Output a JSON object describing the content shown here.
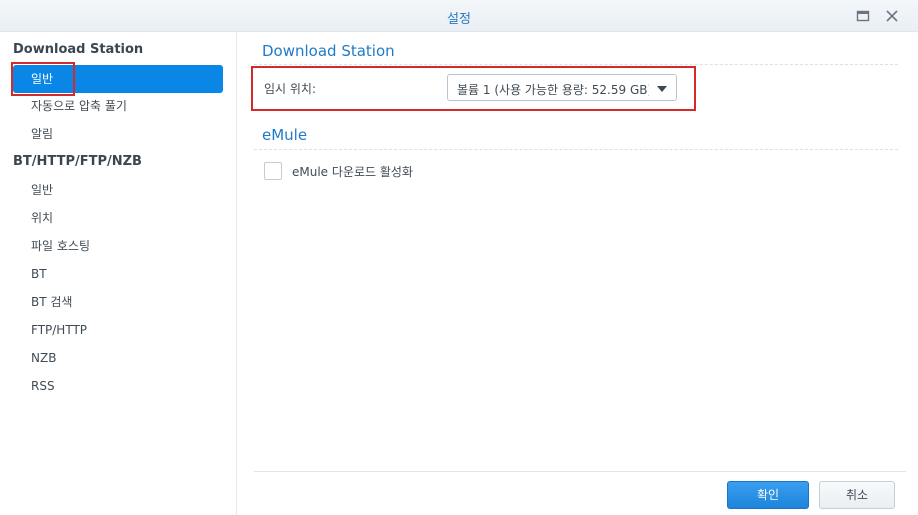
{
  "window": {
    "title": "설정"
  },
  "sidebar": {
    "groups": [
      {
        "heading": "Download Station",
        "items": [
          "일반",
          "자동으로 압축 풀기",
          "알림"
        ]
      },
      {
        "heading": "BT/HTTP/FTP/NZB",
        "items": [
          "일반",
          "위치",
          "파일 호스팅",
          "BT",
          "BT 검색",
          "FTP/HTTP",
          "NZB",
          "RSS"
        ]
      }
    ],
    "active_item": "일반"
  },
  "main": {
    "download_station": {
      "title": "Download Station",
      "temp_location_label": "임시 위치:",
      "temp_location_value": "볼륨 1 (사용 가능한 용량: 52.59 GB)"
    },
    "emule": {
      "title": "eMule",
      "enable_label": "eMule 다운로드 활성화",
      "enabled": false
    }
  },
  "footer": {
    "ok_label": "확인",
    "cancel_label": "취소"
  },
  "colors": {
    "accent": "#0a86e6",
    "highlight": "#d42a2a",
    "title": "#2a78c4"
  }
}
